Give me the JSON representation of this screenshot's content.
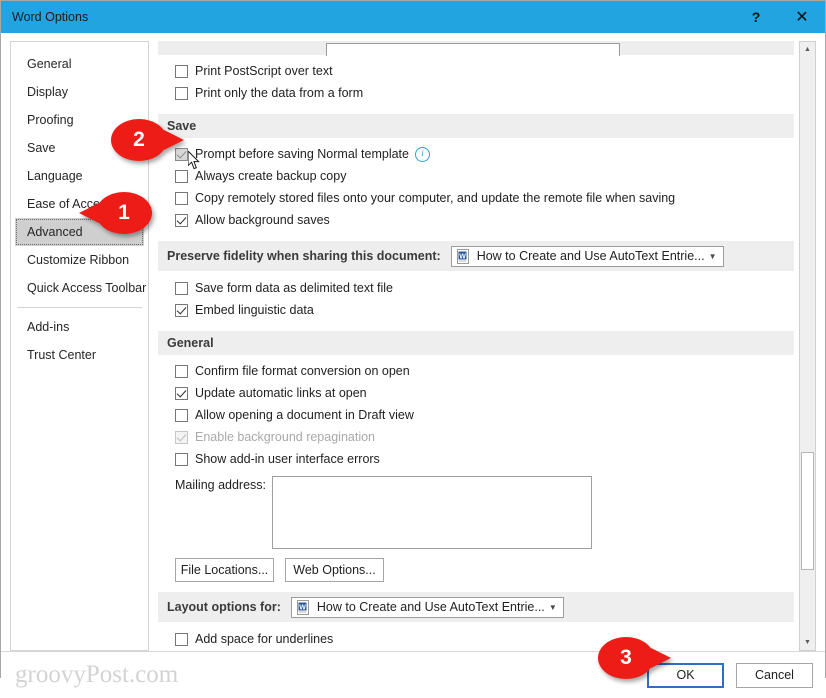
{
  "window": {
    "title": "Word Options",
    "help_label": "?",
    "close_label": "✕"
  },
  "sidebar": {
    "items": [
      {
        "label": "General",
        "selected": false
      },
      {
        "label": "Display",
        "selected": false
      },
      {
        "label": "Proofing",
        "selected": false
      },
      {
        "label": "Save",
        "selected": false
      },
      {
        "label": "Language",
        "selected": false
      },
      {
        "label": "Ease of Access",
        "selected": false
      },
      {
        "label": "Advanced",
        "selected": true
      },
      {
        "label": "Customize Ribbon",
        "selected": false
      },
      {
        "label": "Quick Access Toolbar",
        "selected": false
      }
    ],
    "items_after_separator": [
      {
        "label": "Add-ins",
        "selected": false
      },
      {
        "label": "Trust Center",
        "selected": false
      }
    ]
  },
  "main": {
    "print_group": {
      "options": [
        {
          "label": "Print PostScript over text",
          "checked": false
        },
        {
          "label": "Print only the data from a form",
          "checked": false
        }
      ]
    },
    "save_section": {
      "heading": "Save",
      "options": [
        {
          "label": "Prompt before saving Normal template",
          "checked": true,
          "hover": true,
          "info": true
        },
        {
          "label": "Always create backup copy",
          "checked": false
        },
        {
          "label": "Copy remotely stored files onto your computer, and update the remote file when saving",
          "checked": false
        },
        {
          "label": "Allow background saves",
          "checked": true
        }
      ]
    },
    "preserve_fidelity": {
      "label": "Preserve fidelity when sharing this document:",
      "document": "How to Create and Use AutoText Entrie...",
      "caret": "▼",
      "options": [
        {
          "label": "Save form data as delimited text file",
          "checked": false
        },
        {
          "label": "Embed linguistic data",
          "checked": true
        }
      ]
    },
    "general_section": {
      "heading": "General",
      "options": [
        {
          "label": "Confirm file format conversion on open",
          "checked": false,
          "disabled": false
        },
        {
          "label": "Update automatic links at open",
          "checked": true,
          "disabled": false
        },
        {
          "label": "Allow opening a document in Draft view",
          "checked": false,
          "disabled": false
        },
        {
          "label": "Enable background repagination",
          "checked": true,
          "disabled": true
        },
        {
          "label": "Show add-in user interface errors",
          "checked": false,
          "disabled": false
        }
      ],
      "mailing_address_label": "Mailing address:",
      "mailing_address_value": "",
      "file_locations_button": "File Locations...",
      "web_options_button": "Web Options..."
    },
    "layout_options": {
      "label": "Layout options for:",
      "document": "How to Create and Use AutoText Entrie...",
      "caret": "▼",
      "options": [
        {
          "label": "Add space for underlines",
          "checked": false
        }
      ]
    }
  },
  "scrollbar": {
    "up_arrow": "▲",
    "down_arrow": "▼"
  },
  "footer": {
    "watermark": "groovyPost.com",
    "ok_label": "OK",
    "cancel_label": "Cancel"
  },
  "callouts": [
    {
      "number": "1",
      "direction": "left"
    },
    {
      "number": "2",
      "direction": "right"
    },
    {
      "number": "3",
      "direction": "right"
    }
  ],
  "colors": {
    "titlebar": "#21a4df",
    "callout_red": "#ed1c16",
    "section_band": "#eeeeee",
    "selected_item": "#cfcfcf",
    "primary_button_border": "#2f6fc0"
  }
}
